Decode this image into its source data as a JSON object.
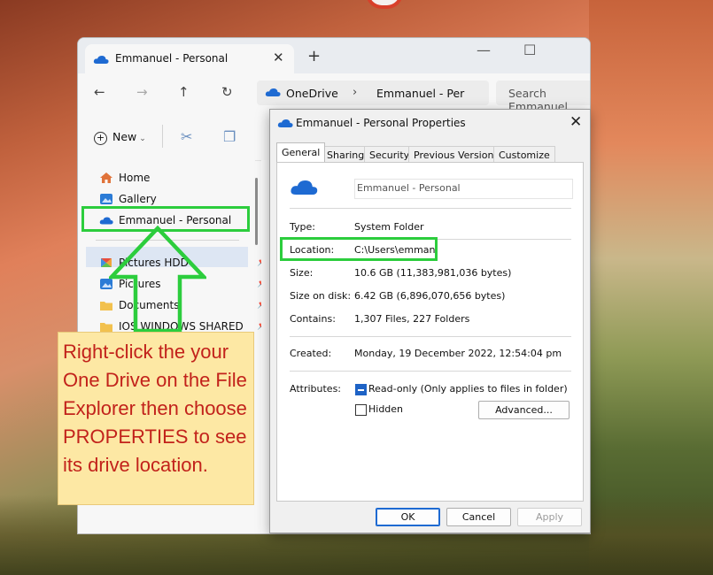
{
  "explorer": {
    "tab_title": "Emmanuel - Personal",
    "address": {
      "segment1": "OneDrive",
      "segment2": "Emmanuel - Per"
    },
    "search_placeholder": "Search Emmanuel",
    "new_label": "New",
    "nav_items": [
      {
        "label": "Home",
        "icon": "home-icon"
      },
      {
        "label": "Gallery",
        "icon": "gallery-icon"
      },
      {
        "label": "Emmanuel - Personal",
        "icon": "onedrive-cloud-icon"
      },
      {
        "label": "Pictures HDD",
        "icon": "pictures-icon"
      },
      {
        "label": "Pictures",
        "icon": "pictures-icon"
      },
      {
        "label": "Documents",
        "icon": "folder-icon"
      },
      {
        "label": "IOS WINDOWS SHARED",
        "icon": "folder-icon"
      }
    ]
  },
  "callout": {
    "text": "Right-click the your One Drive on the File Explorer then choose PROPERTIES to see its drive location."
  },
  "properties": {
    "title": "Emmanuel - Personal Properties",
    "tabs": [
      "General",
      "Sharing",
      "Security",
      "Previous Versions",
      "Customize"
    ],
    "active_tab": "General",
    "name": "Emmanuel - Personal",
    "type_label": "Type:",
    "type_value": "System Folder",
    "location_label": "Location:",
    "location_value": "C:\\Users\\emman",
    "size_label": "Size:",
    "size_value": "10.6 GB (11,383,981,036 bytes)",
    "size_on_disk_label": "Size on disk:",
    "size_on_disk_value": "6.42 GB (6,896,070,656 bytes)",
    "contains_label": "Contains:",
    "contains_value": "1,307 Files, 227 Folders",
    "created_label": "Created:",
    "created_value": "Monday, 19 December 2022, 12:54:04 pm",
    "attributes_label": "Attributes:",
    "readonly_label": "Read-only (Only applies to files in folder)",
    "readonly_checked": true,
    "hidden_label": "Hidden",
    "hidden_checked": false,
    "advanced_label": "Advanced...",
    "ok_label": "OK",
    "cancel_label": "Cancel",
    "apply_label": "Apply"
  },
  "colors": {
    "highlight_green": "#2ccd3d",
    "callout_text": "#c2221b",
    "callout_bg": "#fde8a4",
    "onedrive_blue": "#1e6ad2"
  }
}
